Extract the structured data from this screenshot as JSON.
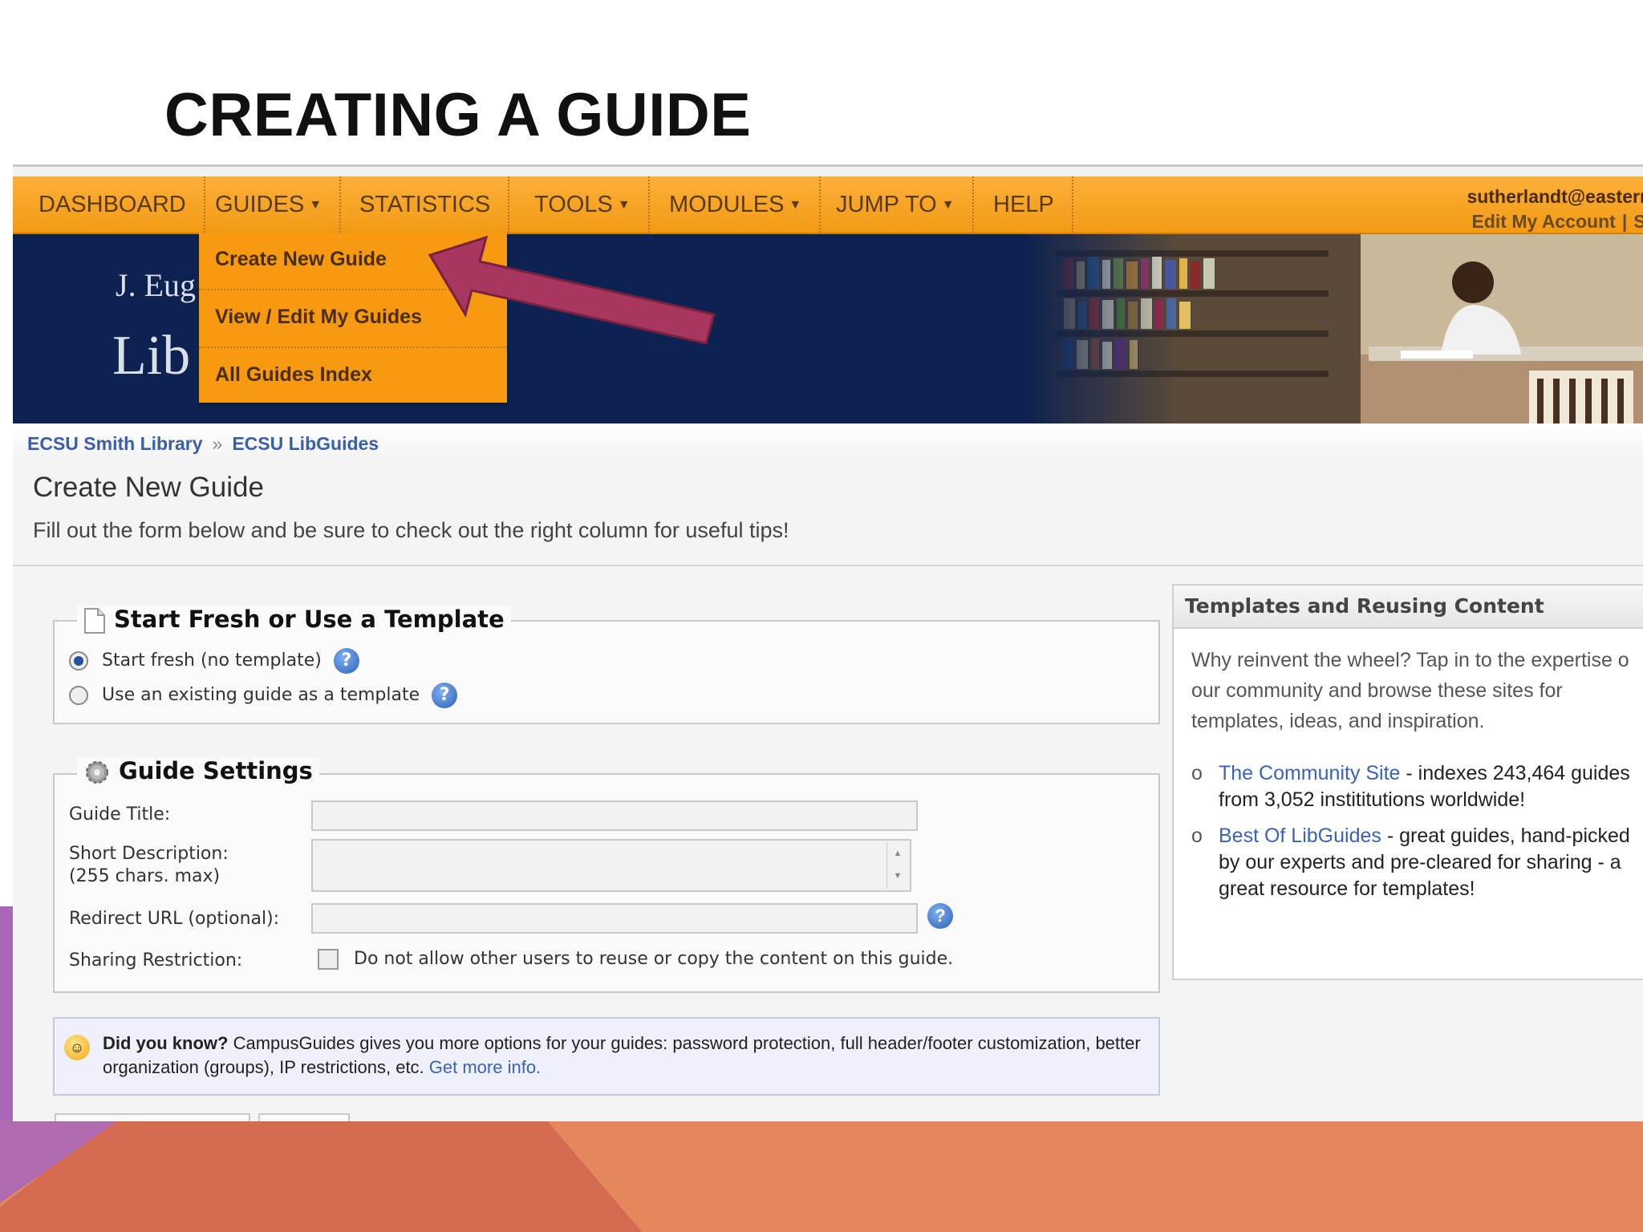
{
  "slide": {
    "title": "CREATING A GUIDE"
  },
  "nav": {
    "items": [
      "DASHBOARD",
      "GUIDES",
      "STATISTICS",
      "TOOLS",
      "MODULES",
      "JUMP TO",
      "HELP"
    ],
    "has_caret": [
      false,
      true,
      false,
      true,
      true,
      true,
      false
    ],
    "account_email": "sutherlandt@eastern",
    "edit_account": "Edit My Account",
    "sign_out": "Si"
  },
  "banner": {
    "line1": "J. Eug",
    "line2": "Lib"
  },
  "dropdown": {
    "items": [
      "Create New Guide",
      "View / Edit My Guides",
      "All Guides Index"
    ]
  },
  "breadcrumb": {
    "item1": "ECSU Smith Library",
    "separator": "»",
    "item2": "ECSU LibGuides"
  },
  "page": {
    "heading": "Create New Guide",
    "subheading": "Fill out the form below and be sure to check out the right column for useful tips!"
  },
  "template_section": {
    "legend": "Start Fresh or Use a Template",
    "option1": "Start fresh (no template)",
    "option2": "Use an existing guide as a template",
    "selected": "option1"
  },
  "settings_section": {
    "legend": "Guide Settings",
    "title_label": "Guide Title:",
    "desc_label_1": "Short Description:",
    "desc_label_2": "(255 chars. max)",
    "redirect_label": "Redirect URL (optional):",
    "sharing_label": "Sharing Restriction:",
    "sharing_checkbox_text": "Do not allow other users to reuse or copy the content on this guide."
  },
  "sidebar": {
    "heading": "Templates and Reusing Content",
    "intro": "Why reinvent the wheel? Tap in to the expertise o our community and browse these sites for templates, ideas, and inspiration.",
    "items": [
      {
        "link": "The Community Site",
        "text": " - indexes 243,464 guides from 3,052 instititutions worldwide!"
      },
      {
        "link": "Best Of LibGuides",
        "text": " - great guides, hand-picked by our experts and pre-cleared for sharing - a great resource for templates!"
      }
    ]
  },
  "did_you_know": {
    "bold": "Did you know?",
    "text": " CampusGuides gives you more options for your guides: password protection, full header/footer customization, better organization (groups), IP restrictions, etc. ",
    "link": "Get more info."
  },
  "colors": {
    "nav_orange": "#f39a14",
    "banner_navy": "#0d2250",
    "arrow": "#a8375f",
    "link_blue": "#3a62b8",
    "deco_orange": "#e4875c",
    "deco_red": "#d46a50",
    "deco_purple": "#a866b6"
  },
  "icons": {
    "help": "help-question-icon",
    "smiley": "smiley-icon",
    "page": "page-icon",
    "gear": "gear-icon"
  }
}
